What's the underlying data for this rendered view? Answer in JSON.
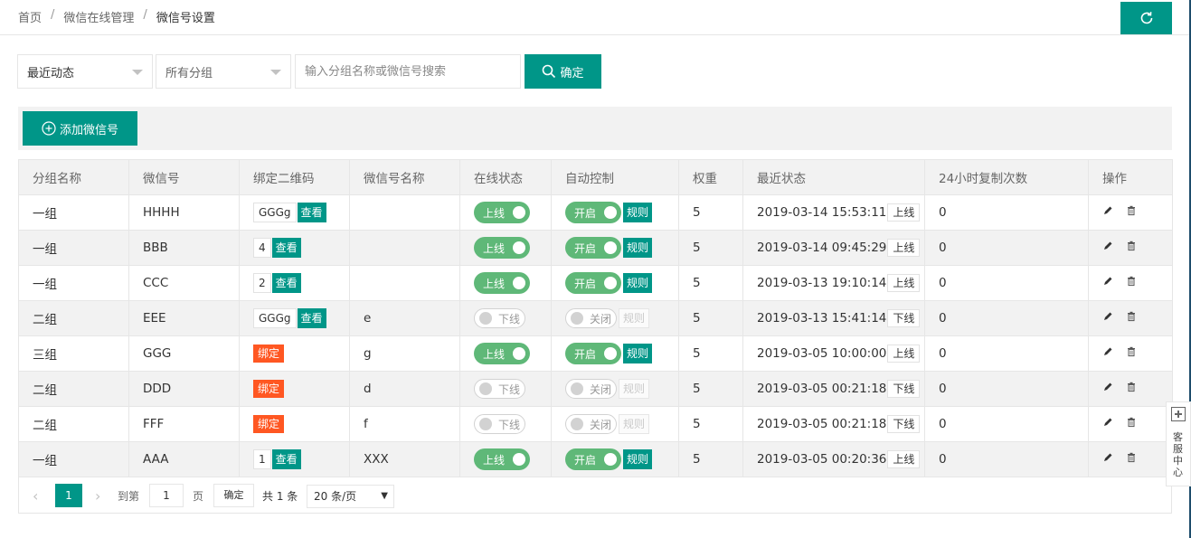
{
  "breadcrumb": {
    "home": "首页",
    "section": "微信在线管理",
    "current": "微信号设置",
    "separator": "/"
  },
  "filters": {
    "activity_select": "最近动态",
    "group_select": "所有分组",
    "search_placeholder": "输入分组名称或微信号搜索",
    "confirm_label": "确定"
  },
  "toolbar": {
    "add_label": "添加微信号"
  },
  "table": {
    "headers": [
      "分组名称",
      "微信号",
      "绑定二维码",
      "微信号名称",
      "在线状态",
      "自动控制",
      "权重",
      "最近状态",
      "24小时复制次数",
      "操作"
    ],
    "view_label": "查看",
    "bind_label": "绑定",
    "rule_label": "规则",
    "rows": [
      {
        "group": "一组",
        "account": "HHHH",
        "qr": "GGGg",
        "name": "",
        "online": "上线",
        "online_on": true,
        "auto": "开启",
        "auto_on": true,
        "weight": "5",
        "time": "2019-03-14 15:53:11",
        "status": "上线",
        "copies": "0"
      },
      {
        "group": "一组",
        "account": "BBB",
        "qr": "4",
        "name": "",
        "online": "上线",
        "online_on": true,
        "auto": "开启",
        "auto_on": true,
        "weight": "5",
        "time": "2019-03-14 09:45:29",
        "status": "上线",
        "copies": "0"
      },
      {
        "group": "一组",
        "account": "CCC",
        "qr": "2",
        "name": "",
        "online": "上线",
        "online_on": true,
        "auto": "开启",
        "auto_on": true,
        "weight": "5",
        "time": "2019-03-13 19:10:14",
        "status": "上线",
        "copies": "0"
      },
      {
        "group": "二组",
        "account": "EEE",
        "qr": "GGGg",
        "name": "e",
        "online": "下线",
        "online_on": false,
        "auto": "关闭",
        "auto_on": false,
        "weight": "5",
        "time": "2019-03-13 15:41:14",
        "status": "下线",
        "copies": "0"
      },
      {
        "group": "三组",
        "account": "GGG",
        "qr": "",
        "name": "g",
        "online": "上线",
        "online_on": true,
        "auto": "开启",
        "auto_on": true,
        "weight": "5",
        "time": "2019-03-05 10:00:00",
        "status": "上线",
        "copies": "0"
      },
      {
        "group": "二组",
        "account": "DDD",
        "qr": "",
        "name": "d",
        "online": "下线",
        "online_on": false,
        "auto": "关闭",
        "auto_on": false,
        "weight": "5",
        "time": "2019-03-05 00:21:18",
        "status": "下线",
        "copies": "0"
      },
      {
        "group": "二组",
        "account": "FFF",
        "qr": "",
        "name": "f",
        "online": "下线",
        "online_on": false,
        "auto": "关闭",
        "auto_on": false,
        "weight": "5",
        "time": "2019-03-05 00:21:18",
        "status": "下线",
        "copies": "0"
      },
      {
        "group": "一组",
        "account": "AAA",
        "qr": "1",
        "name": "XXX",
        "online": "上线",
        "online_on": true,
        "auto": "开启",
        "auto_on": true,
        "weight": "5",
        "time": "2019-03-05 00:20:36",
        "status": "上线",
        "copies": "0"
      }
    ]
  },
  "pagination": {
    "current_page": "1",
    "goto_label": "到第",
    "goto_value": "1",
    "page_unit": "页",
    "confirm_label": "确定",
    "total_label": "共 1 条",
    "page_size": "20 条/页"
  },
  "float_panel": {
    "label": "客服中心"
  },
  "colors": {
    "primary": "#009688",
    "switch_on": "#5fb878",
    "bind": "#ff5722"
  },
  "icons": {
    "refresh": "refresh-icon",
    "search": "search-icon",
    "add": "plus-circle-icon",
    "edit": "pencil-icon",
    "delete": "trash-icon"
  }
}
